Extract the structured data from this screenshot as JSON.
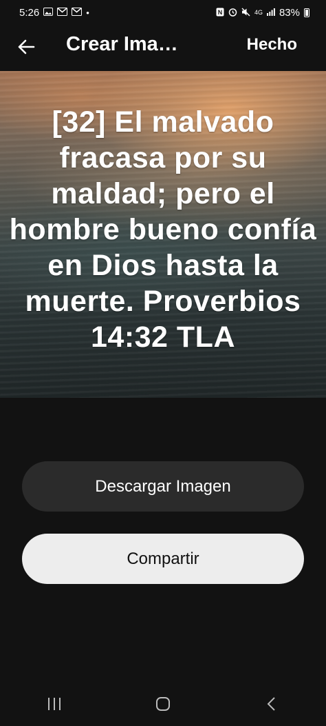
{
  "status_bar": {
    "time": "5:26",
    "battery": "83%",
    "network": "4G",
    "icons": [
      "image-icon",
      "gmail-icon",
      "gmail-icon",
      "dot-icon",
      "nfc-icon",
      "alarm-icon",
      "mute-icon",
      "signal-icon",
      "battery-icon"
    ]
  },
  "app_bar": {
    "title": "Crear Ima…",
    "done_label": "Hecho"
  },
  "verse": {
    "text": "[32] El malvado fracasa por su maldad; pero el hombre bueno confía en Dios hasta la muerte. Proverbios 14:32 TLA"
  },
  "actions": {
    "download_label": "Descargar Imagen",
    "share_label": "Compartir"
  },
  "colors": {
    "background": "#121212",
    "download_button": "#2b2b2b",
    "share_button": "#ededed"
  }
}
